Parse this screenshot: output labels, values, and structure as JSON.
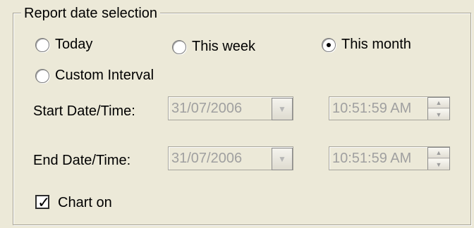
{
  "group": {
    "title": "Report date selection"
  },
  "options": {
    "today": "Today",
    "this_week": "This week",
    "this_month": "This month",
    "custom_interval": "Custom Interval",
    "selected": "this_month"
  },
  "start": {
    "label": "Start Date/Time:",
    "date": "31/07/2006",
    "time": "10:51:59 AM"
  },
  "end": {
    "label": "End Date/Time:",
    "date": "31/07/2006",
    "time": "10:51:59 AM"
  },
  "chart": {
    "label": "Chart on",
    "checked": true
  },
  "icons": {
    "dropdown": "chevron-down-icon",
    "spin_up": "arrow-up-icon",
    "spin_down": "arrow-down-icon",
    "checkbox": "check-icon"
  }
}
